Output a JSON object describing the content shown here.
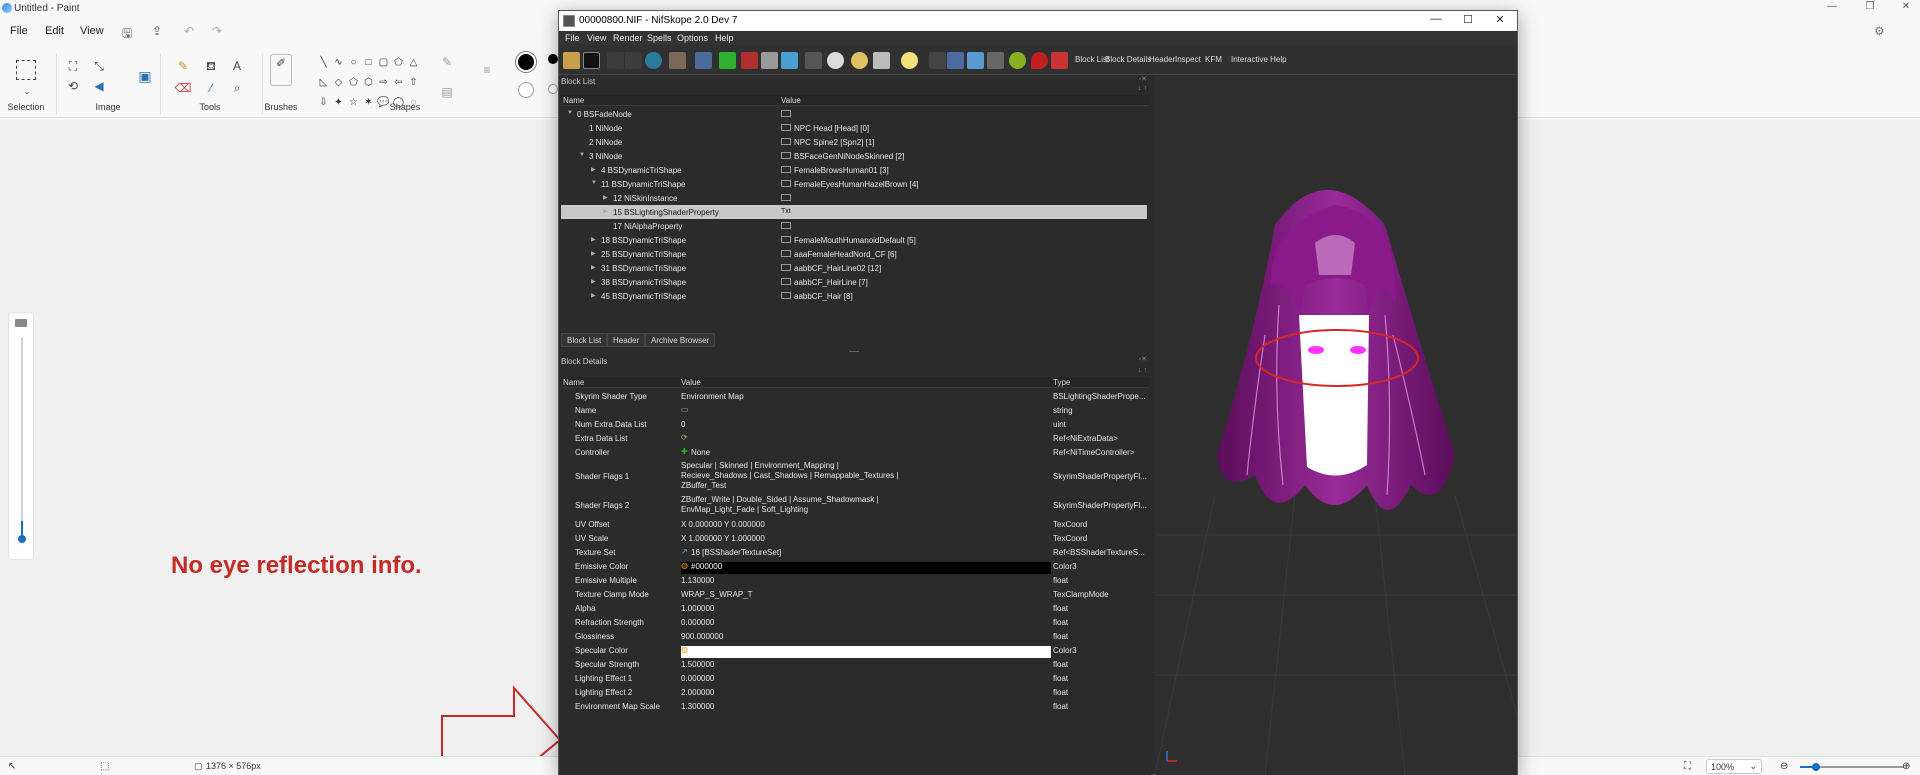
{
  "paint": {
    "title": "Untitled - Paint",
    "menu": [
      "File",
      "Edit",
      "View"
    ],
    "ribbon_groups": [
      "Selection",
      "Image",
      "Tools",
      "Brushes",
      "Shapes"
    ],
    "annotation": "No eye reflection info.",
    "status": {
      "canvas_size": "1376 × 576px",
      "zoom": "100%"
    }
  },
  "nifskope": {
    "title": "00000800.NIF - NifSkope 2.0 Dev 7",
    "menu": [
      "File",
      "View",
      "Render",
      "Spells",
      "Options",
      "Help"
    ],
    "toolbar_links": [
      "Block List",
      "Block Details",
      "Header",
      "Inspect",
      "KFM",
      "Interactive Help"
    ],
    "block_list": {
      "title": "Block List",
      "columns": [
        "Name",
        "Value"
      ],
      "rows": [
        {
          "twisty": "▼",
          "name": "0 BSFadeNode",
          "value": ""
        },
        {
          "twisty": "",
          "name": "1 NiNode",
          "value": "NPC Head [Head] [0]"
        },
        {
          "twisty": "",
          "name": "2 NiNode",
          "value": "NPC Spine2 [Spn2] [1]"
        },
        {
          "twisty": "▼",
          "name": "3 NiNode",
          "value": "BSFaceGenNiNodeSkinned [2]"
        },
        {
          "twisty": "▶",
          "name": "4 BSDynamicTriShape",
          "value": "FemaleBrowsHuman01 [3]"
        },
        {
          "twisty": "▼",
          "name": "11 BSDynamicTriShape",
          "value": "FemaleEyesHumanHazelBrown [4]"
        },
        {
          "twisty": "▶",
          "name": "12 NiSkinInstance",
          "value": ""
        },
        {
          "twisty": "▶",
          "name": "15 BSLightingShaderProperty",
          "value": "Txt"
        },
        {
          "twisty": "",
          "name": "17 NiAlphaProperty",
          "value": ""
        },
        {
          "twisty": "▶",
          "name": "18 BSDynamicTriShape",
          "value": "FemaleMouthHumanoidDefault [5]"
        },
        {
          "twisty": "▶",
          "name": "25 BSDynamicTriShape",
          "value": "aaaFemaleHeadNord_CF [6]"
        },
        {
          "twisty": "▶",
          "name": "31 BSDynamicTriShape",
          "value": "aabbCF_HairLine02 [12]"
        },
        {
          "twisty": "▶",
          "name": "38 BSDynamicTriShape",
          "value": "aabbCF_HairLine [7]"
        },
        {
          "twisty": "▶",
          "name": "45 BSDynamicTriShape",
          "value": "aabbCF_Hair [8]"
        }
      ]
    },
    "tabs": [
      "Block List",
      "Header",
      "Archive Browser"
    ],
    "block_details": {
      "title": "Block Details",
      "columns": [
        "Name",
        "Value",
        "Type"
      ],
      "rows": [
        {
          "name": "Skyrim Shader Type",
          "value": "Environment Map",
          "type": "BSLightingShaderPrope..."
        },
        {
          "name": "Name",
          "value": "",
          "type": "string"
        },
        {
          "name": "Num Extra Data List",
          "value": "0",
          "type": "uint"
        },
        {
          "name": "Extra Data List",
          "value": "",
          "type": "Ref<NiExtraData>"
        },
        {
          "name": "Controller",
          "value": "None",
          "type": "Ref<NiTimeController>"
        },
        {
          "name": "Shader Flags 1",
          "value": "Specular | Skinned | Environment_Mapping |\nRecieve_Shadows | Cast_Shadows | Remappable_Textures |\nZBuffer_Test",
          "type": "SkyrimShaderPropertyFl..."
        },
        {
          "name": "Shader Flags 2",
          "value": "ZBuffer_Write | Double_Sided | Assume_Shadowmask |\nEnvMap_Light_Fade | Soft_Lighting",
          "type": "SkyrimShaderPropertyFl..."
        },
        {
          "name": "UV Offset",
          "value": "X 0.000000 Y 0.000000",
          "type": "TexCoord"
        },
        {
          "name": "UV Scale",
          "value": "X 1.000000 Y 1.000000",
          "type": "TexCoord"
        },
        {
          "name": "Texture Set",
          "value": "16 [BSShaderTextureSet]",
          "type": "Ref<BSShaderTextureS..."
        },
        {
          "name": "Emissive Color",
          "value": "#000000",
          "type": "Color3"
        },
        {
          "name": "Emissive Multiple",
          "value": "1.130000",
          "type": "float"
        },
        {
          "name": "Texture Clamp Mode",
          "value": "WRAP_S_WRAP_T",
          "type": "TexClampMode"
        },
        {
          "name": "Alpha",
          "value": "1.000000",
          "type": "float"
        },
        {
          "name": "Refraction Strength",
          "value": "0.000000",
          "type": "float"
        },
        {
          "name": "Glossiness",
          "value": "900.000000",
          "type": "float"
        },
        {
          "name": "Specular Color",
          "value": "",
          "type": "Color3"
        },
        {
          "name": "Specular Strength",
          "value": "1.500000",
          "type": "float"
        },
        {
          "name": "Lighting Effect 1",
          "value": "0.000000",
          "type": "float"
        },
        {
          "name": "Lighting Effect 2",
          "value": "2.000000",
          "type": "float"
        },
        {
          "name": "Environment Map Scale",
          "value": "1.300000",
          "type": "float"
        }
      ]
    }
  },
  "colors": {
    "annotation_red": "#c52a25",
    "selection_row": "#c8c8c8",
    "hair": "#8a1a8a",
    "accent": "#1a6fc4"
  }
}
